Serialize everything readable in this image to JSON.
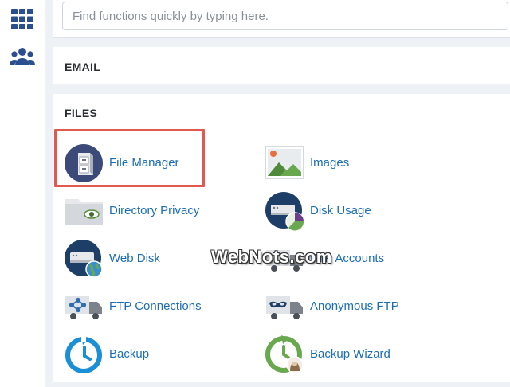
{
  "sidebar": {
    "items": [
      {
        "name": "grid-icon"
      },
      {
        "name": "users-icon"
      }
    ]
  },
  "search": {
    "placeholder": "Find functions quickly by typing here.",
    "value": ""
  },
  "sections": {
    "email": {
      "title": "EMAIL"
    },
    "files": {
      "title": "FILES",
      "items": [
        {
          "label": "File Manager",
          "icon": "file-manager-icon"
        },
        {
          "label": "Images",
          "icon": "images-icon"
        },
        {
          "label": "Directory Privacy",
          "icon": "directory-privacy-icon"
        },
        {
          "label": "Disk Usage",
          "icon": "disk-usage-icon"
        },
        {
          "label": "Web Disk",
          "icon": "web-disk-icon"
        },
        {
          "label": "FTP Accounts",
          "icon": "ftp-accounts-icon"
        },
        {
          "label": "FTP Connections",
          "icon": "ftp-connections-icon"
        },
        {
          "label": "Anonymous FTP",
          "icon": "anonymous-ftp-icon"
        },
        {
          "label": "Backup",
          "icon": "backup-icon"
        },
        {
          "label": "Backup Wizard",
          "icon": "backup-wizard-icon"
        }
      ]
    }
  },
  "watermark": {
    "text": "WebNots.com"
  },
  "colors": {
    "link": "#1c6eb4",
    "highlight": "#e0584f",
    "icon_dark": "#3b4a78",
    "icon_blue": "#1a8fd6",
    "icon_green": "#6aa84f"
  }
}
